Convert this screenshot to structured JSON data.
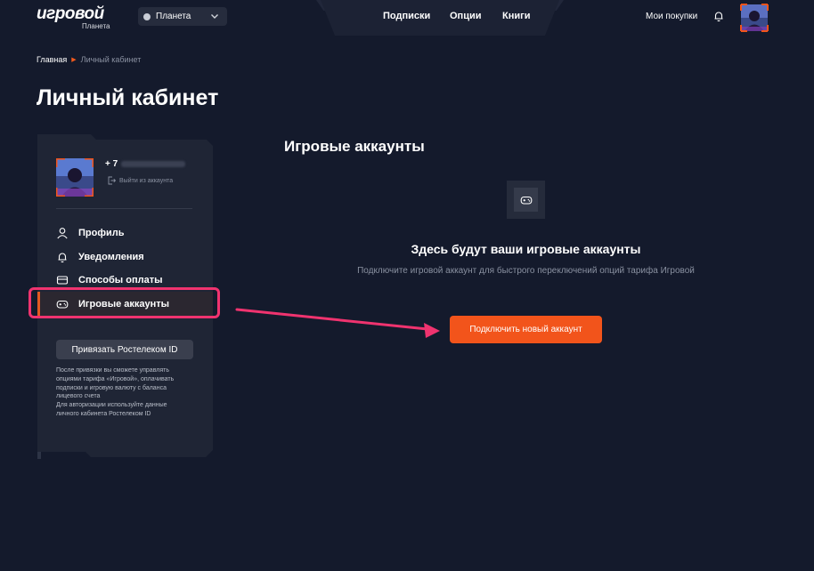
{
  "header": {
    "logo": "игровой",
    "logo_sub": "Планета",
    "city": "Планета",
    "nav": [
      "Подписки",
      "Опции",
      "Книги"
    ],
    "purchases": "Мои покупки"
  },
  "breadcrumb": {
    "home": "Главная",
    "current": "Личный кабинет"
  },
  "page_title": "Личный кабинет",
  "sidebar": {
    "phone_prefix": "+ 7",
    "logout": "Выйти из аккаунта",
    "menu": [
      "Профиль",
      "Уведомления",
      "Способы оплаты",
      "Игровые аккаунты"
    ],
    "bind_button": "Привязать Ростелеком ID",
    "bind_note": "После привязки вы сможете управлять опциями тарифа «Игровой», оплачивать подписки и игровую валюту с баланса лицевого счета\nДля авторизации используйте данные личного кабинета Ростелеком ID"
  },
  "main": {
    "title": "Игровые аккаунты",
    "empty_title": "Здесь будут ваши игровые аккаунты",
    "empty_desc": "Подключите игровой аккаунт для быстрого переключений опций тарифа Игровой",
    "connect_button": "Подключить новый аккаунт"
  },
  "colors": {
    "accent": "#f2541b",
    "annotation": "#f0336f",
    "background": "#141a2c"
  }
}
